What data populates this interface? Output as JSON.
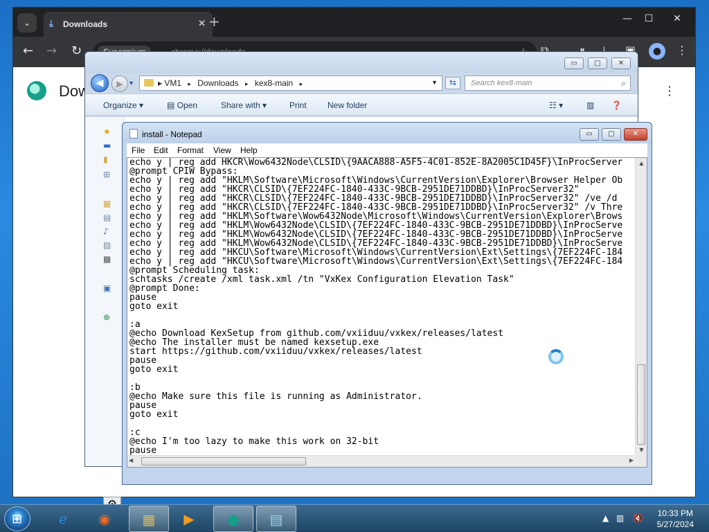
{
  "browser": {
    "tab_title": "Downloads",
    "omnibox_chip": "Supermium",
    "omnibox_url": "chrome://downloads",
    "page_title": "Downloads",
    "min_label": "—",
    "max_label": "☐",
    "close_label": "✕"
  },
  "explorer": {
    "breadcrumbs": [
      "VM1",
      "Downloads",
      "kex8-main"
    ],
    "search_placeholder": "Search kex8-main",
    "commands": {
      "organize": "Organize ▾",
      "open": "Open",
      "share_with": "Share with ▾",
      "print": "Print",
      "new_folder": "New folder"
    }
  },
  "notepad": {
    "title": "install - Notepad",
    "menus": [
      "File",
      "Edit",
      "Format",
      "View",
      "Help"
    ],
    "lines": [
      "echo y | reg add HKCR\\Wow6432Node\\CLSID\\{9AACA888-A5F5-4C01-852E-8A2005C1D45F}\\InProcServer",
      "@prompt CPIW Bypass:",
      "echo y | reg add \"HKLM\\Software\\Microsoft\\Windows\\CurrentVersion\\Explorer\\Browser Helper Ob",
      "echo y | reg add \"HKCR\\CLSID\\{7EF224FC-1840-433C-9BCB-2951DE71DDBD}\\InProcServer32\"",
      "echo y | reg add \"HKCR\\CLSID\\{7EF224FC-1840-433C-9BCB-2951DE71DDBD}\\InProcServer32\" /ve /d",
      "echo y | reg add \"HKCR\\CLSID\\{7EF224FC-1840-433C-9BCB-2951DE71DDBD}\\InProcServer32\" /v Thre",
      "echo y | reg add \"HKLM\\Software\\Wow6432Node\\Microsoft\\Windows\\CurrentVersion\\Explorer\\Brows",
      "echo y | reg add \"HKLM\\Wow6432Node\\CLSID\\{7EF224FC-1840-433C-9BCB-2951DE71DDBD}\\InProcServe",
      "echo y | reg add \"HKLM\\Wow6432Node\\CLSID\\{7EF224FC-1840-433C-9BCB-2951DE71DDBD}\\InProcServe",
      "echo y | reg add \"HKLM\\Wow6432Node\\CLSID\\{7EF224FC-1840-433C-9BCB-2951DE71DDBD}\\InProcServe",
      "echo y | reg add \"HKCU\\Software\\Microsoft\\Windows\\CurrentVersion\\Ext\\Settings\\{7EF224FC-184",
      "echo y | reg add \"HKCU\\Software\\Microsoft\\Windows\\CurrentVersion\\Ext\\Settings\\{7EF224FC-184",
      "@prompt Scheduling task:",
      "schtasks /create /xml task.xml /tn \"VxKex Configuration Elevation Task\"",
      "@prompt Done:",
      "pause",
      "goto exit",
      "",
      ":a",
      "@echo Download KexSetup from github.com/vxiiduu/vxkex/releases/latest",
      "@echo The installer must be named kexsetup.exe",
      "start https://github.com/vxiiduu/vxkex/releases/latest",
      "pause",
      "goto exit",
      "",
      ":b",
      "@echo Make sure this file is running as Administrator.",
      "pause",
      "goto exit",
      "",
      ":c",
      "@echo I'm too lazy to make this work on 32-bit",
      "pause"
    ]
  },
  "taskbar": {
    "time": "10:33 PM",
    "date": "5/27/2024"
  },
  "colors": {
    "desktop": "#1b6fc4",
    "chrome_dark": "#202124",
    "taskbar": "#1e4563"
  }
}
